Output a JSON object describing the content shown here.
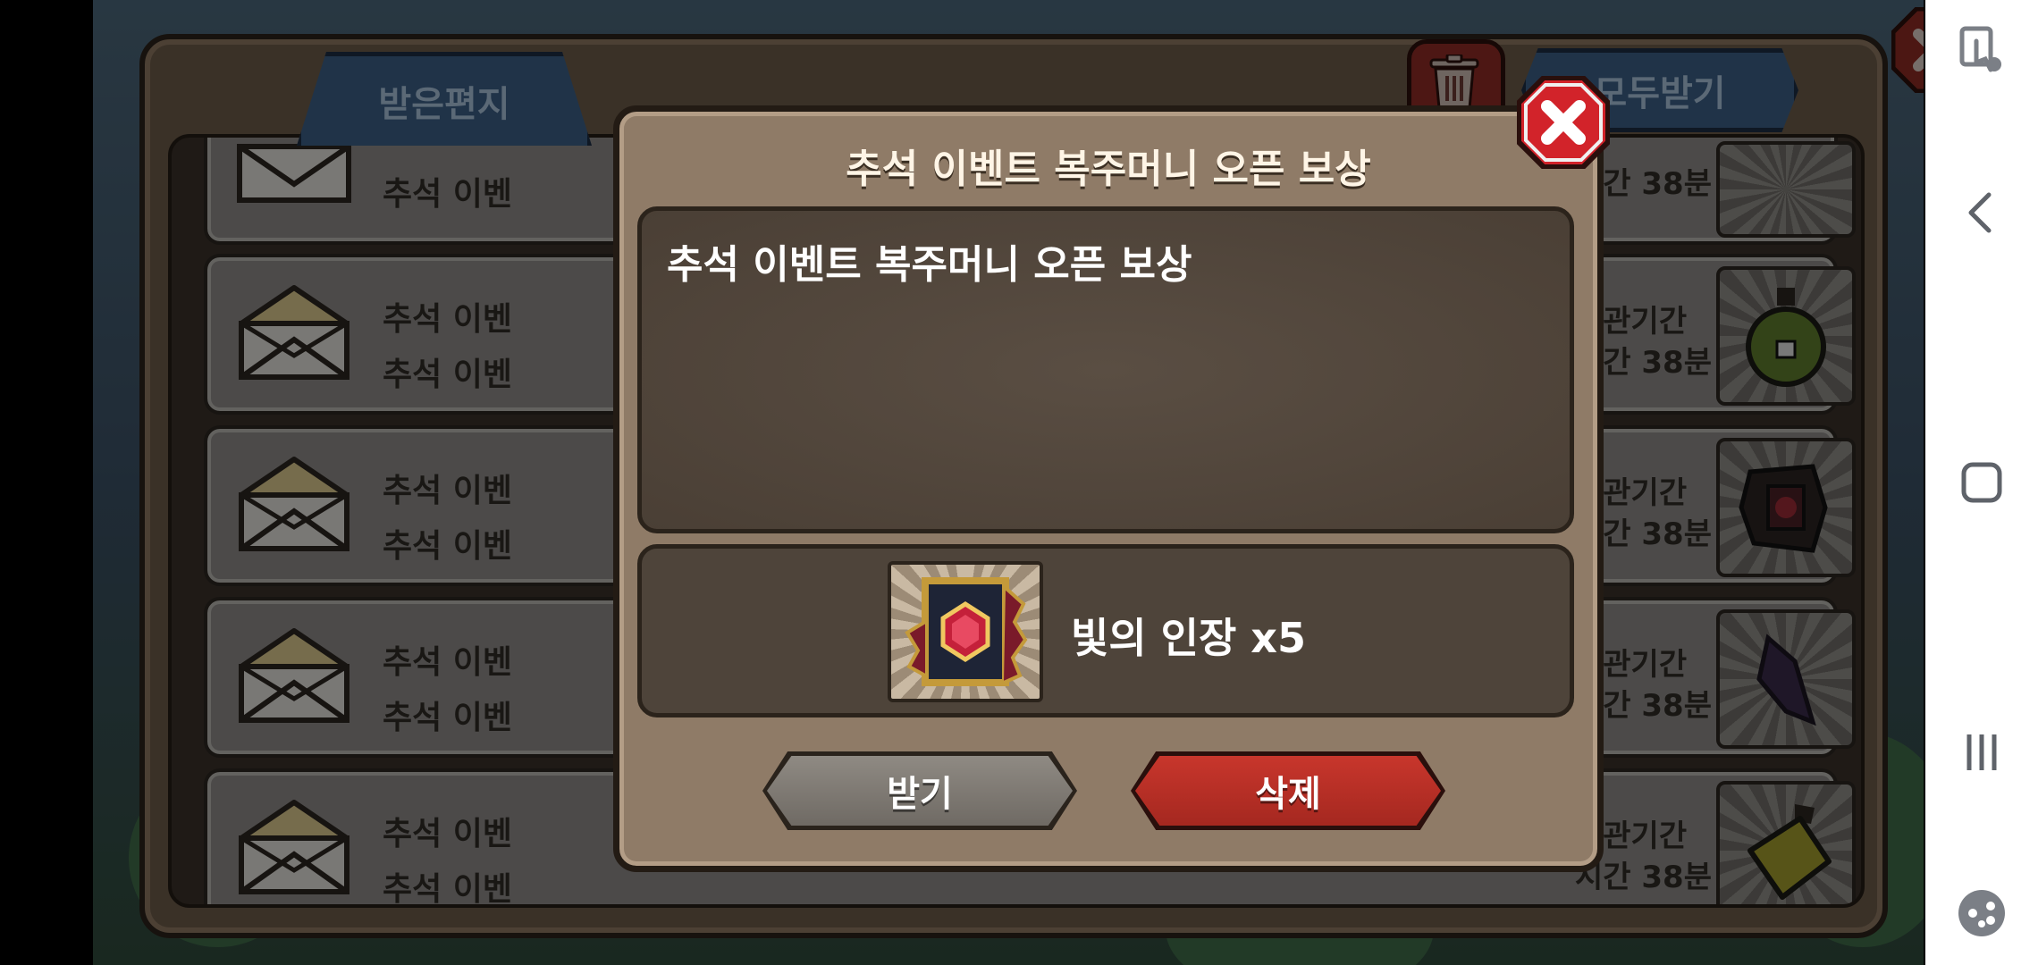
{
  "mail_window": {
    "tab_label": "받은편지",
    "receive_all_label": "모두받기",
    "rows": [
      {
        "line1": "추석 이벤",
        "line2": "",
        "right1": "시간 38분",
        "right2": ""
      },
      {
        "line1": "추석 이벤",
        "line2": "추석 이벤",
        "right1": "보관기간",
        "right2": "시간 38분"
      },
      {
        "line1": "추석 이벤",
        "line2": "추석 이벤",
        "right1": "보관기간",
        "right2": "시간 38분"
      },
      {
        "line1": "추석 이벤",
        "line2": "추석 이벤",
        "right1": "보관기간",
        "right2": "시간 38분"
      },
      {
        "line1": "추석 이벤",
        "line2": "추석 이벤",
        "right1": "보관기간",
        "right2": "시간 38분"
      }
    ]
  },
  "modal": {
    "title": "추석 이벤트 복주머니 오픈 보상",
    "message": "추석 이벤트 복주머니 오픈 보상",
    "reward_label": "빛의 인장 x5",
    "receive_label": "받기",
    "delete_label": "삭제"
  },
  "colors": {
    "delete_red": "#b52d24",
    "tab_blue": "#3b5d84",
    "modal_bg": "#8f7b67"
  },
  "icons": {
    "close": "close-icon",
    "trash": "trash-icon",
    "envelope": "envelope-icon",
    "back": "back-icon",
    "home": "home-icon",
    "recents": "recents-icon",
    "game_tools": "game-tools-icon",
    "touch_protect": "touch-protect-icon"
  }
}
